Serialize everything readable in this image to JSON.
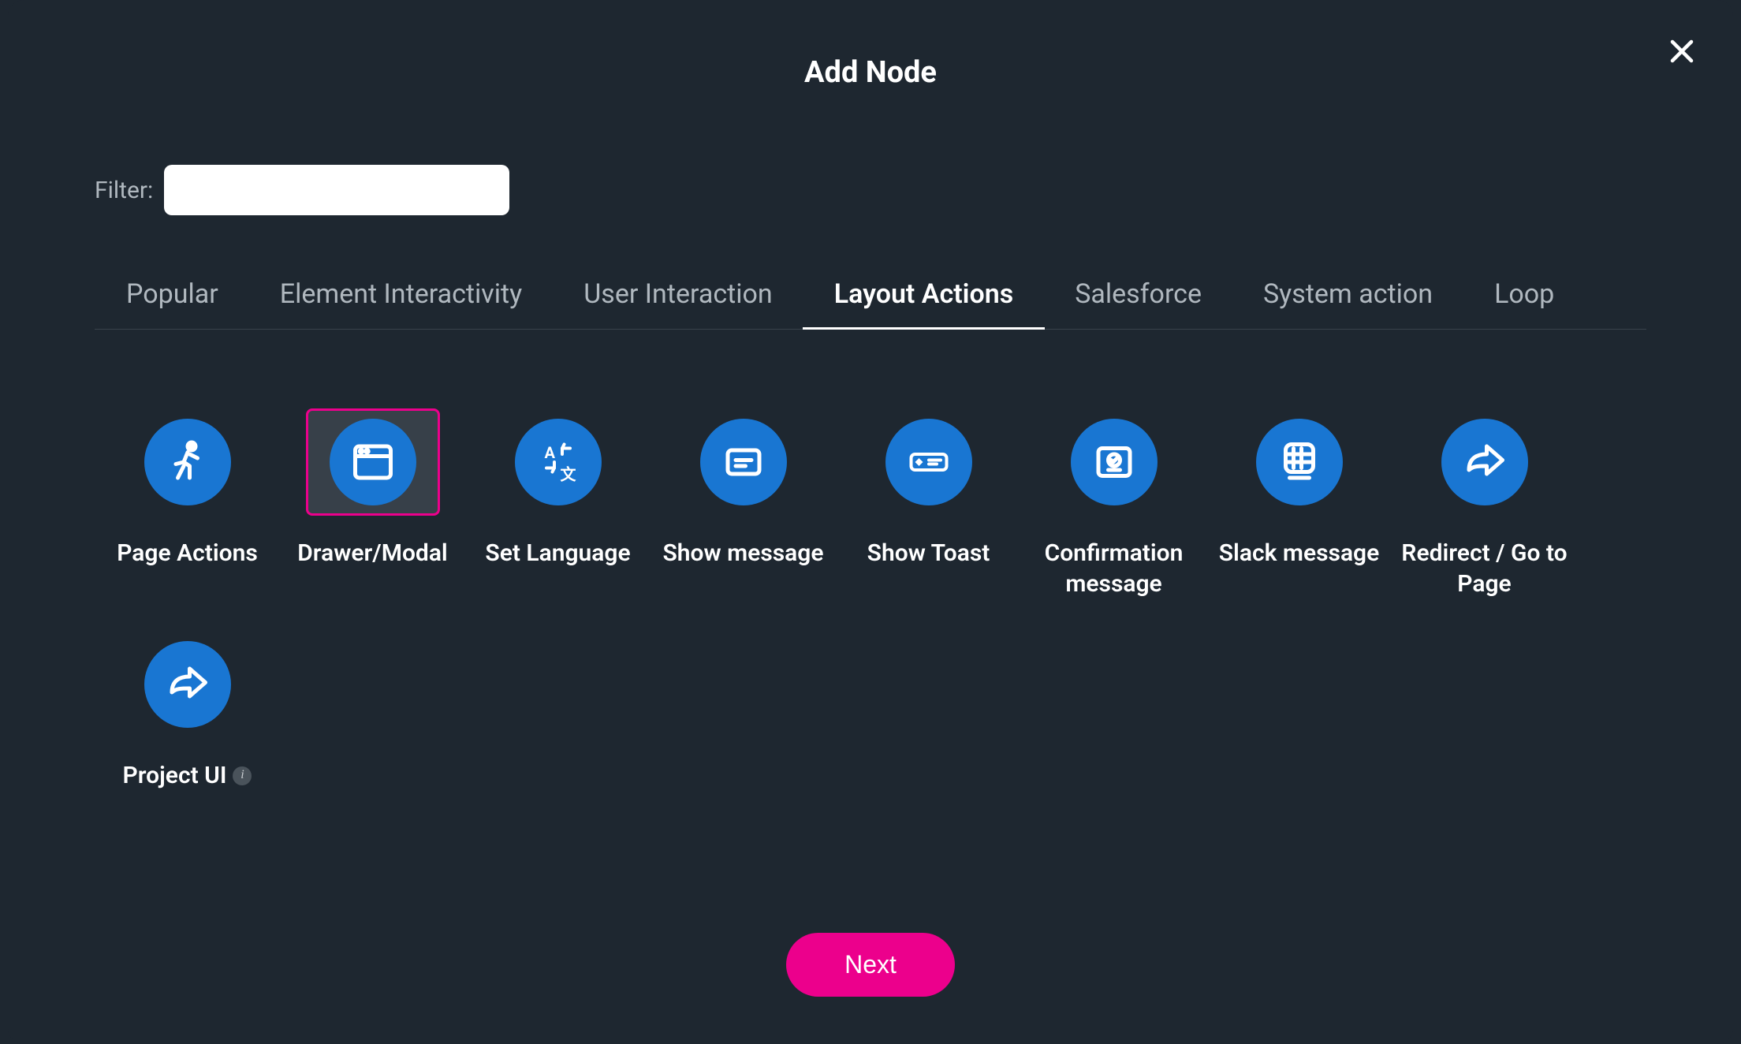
{
  "modal": {
    "title": "Add Node",
    "filter_label": "Filter:",
    "filter_value": ""
  },
  "tabs": [
    {
      "label": "Popular",
      "active": false
    },
    {
      "label": "Element Interactivity",
      "active": false
    },
    {
      "label": "User Interaction",
      "active": false
    },
    {
      "label": "Layout Actions",
      "active": true
    },
    {
      "label": "Salesforce",
      "active": false
    },
    {
      "label": "System action",
      "active": false
    },
    {
      "label": "Loop",
      "active": false
    }
  ],
  "nodes": [
    {
      "label": "Page Actions",
      "icon": "running-person-icon",
      "selected": false,
      "info": false
    },
    {
      "label": "Drawer/Modal",
      "icon": "browser-window-icon",
      "selected": true,
      "info": false
    },
    {
      "label": "Set Language",
      "icon": "translate-icon",
      "selected": false,
      "info": false
    },
    {
      "label": "Show message",
      "icon": "message-box-icon",
      "selected": false,
      "info": false
    },
    {
      "label": "Show Toast",
      "icon": "toast-icon",
      "selected": false,
      "info": false
    },
    {
      "label": "Confirmation message",
      "icon": "confirm-box-icon",
      "selected": false,
      "info": false
    },
    {
      "label": "Slack message",
      "icon": "slack-icon",
      "selected": false,
      "info": false
    },
    {
      "label": "Redirect / Go to Page",
      "icon": "redirect-arrow-icon",
      "selected": false,
      "info": false
    },
    {
      "label": "Project UI",
      "icon": "redirect-arrow-icon",
      "selected": false,
      "info": true
    }
  ],
  "footer": {
    "next_label": "Next"
  },
  "colors": {
    "accent": "#ec008c",
    "icon_bg": "#1976d2",
    "modal_bg": "#1e2730"
  }
}
